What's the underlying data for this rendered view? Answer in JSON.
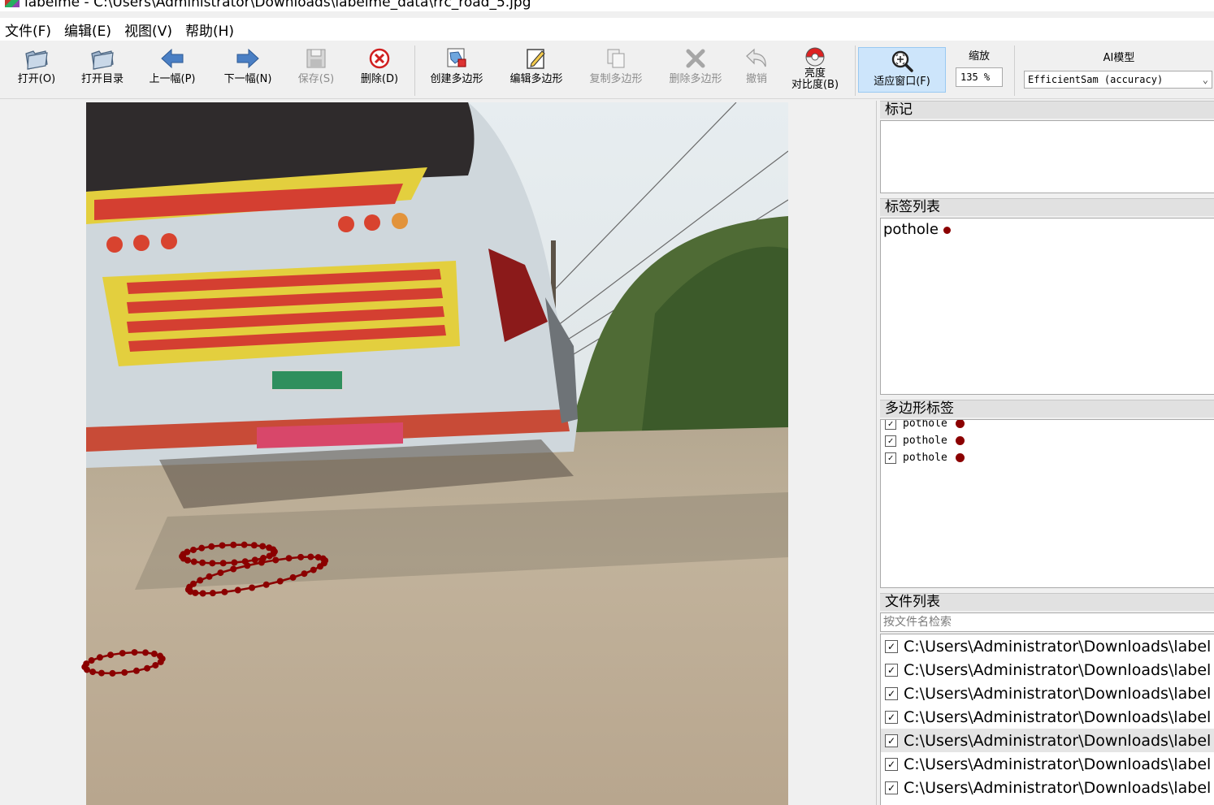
{
  "window": {
    "title": "labelme - C:\\Users\\Administrator\\Downloads\\labelme_data\\rrc_road_5.jpg"
  },
  "menu": [
    "文件(F)",
    "编辑(E)",
    "视图(V)",
    "帮助(H)"
  ],
  "toolbar": {
    "open": "打开(O)",
    "open_dir": "打开目录",
    "prev": "上一幅(P)",
    "next": "下一幅(N)",
    "save": "保存(S)",
    "delete": "删除(D)",
    "create_polygon": "创建多边形",
    "edit_polygon": "编辑多边形",
    "copy_polygon": "复制多边形",
    "delete_polygon": "删除多边形",
    "undo": "撤销",
    "brightness_line1": "亮度",
    "brightness_line2": "对比度(B)",
    "fit_window": "适应窗口(F)",
    "zoom_caption": "缩放",
    "zoom_value": "135 %",
    "ai_caption": "AI模型",
    "ai_model": "EfficientSam (accuracy)"
  },
  "dock": {
    "flags_title": "标记",
    "labels_title": "标签列表",
    "labels": [
      {
        "name": "pothole",
        "color": "#800000"
      }
    ],
    "polygons_title": "多边形标签",
    "polygons": [
      {
        "label": "pothole",
        "checked": true,
        "color": "#800000"
      },
      {
        "label": "pothole",
        "checked": true,
        "color": "#800000"
      },
      {
        "label": "pothole",
        "checked": true,
        "color": "#800000"
      }
    ],
    "files_title": "文件列表",
    "files_search_placeholder": "按文件名检索",
    "files": [
      {
        "path": "C:\\Users\\Administrator\\Downloads\\label",
        "checked": true,
        "selected": false
      },
      {
        "path": "C:\\Users\\Administrator\\Downloads\\label",
        "checked": true,
        "selected": false
      },
      {
        "path": "C:\\Users\\Administrator\\Downloads\\label",
        "checked": true,
        "selected": false
      },
      {
        "path": "C:\\Users\\Administrator\\Downloads\\label",
        "checked": true,
        "selected": false
      },
      {
        "path": "C:\\Users\\Administrator\\Downloads\\label",
        "checked": true,
        "selected": true
      },
      {
        "path": "C:\\Users\\Administrator\\Downloads\\label",
        "checked": true,
        "selected": false
      },
      {
        "path": "C:\\Users\\Administrator\\Downloads\\label",
        "checked": true,
        "selected": false
      }
    ]
  },
  "colors": {
    "annotation": "#8b0000",
    "active_tool_bg": "#cde5fb"
  }
}
